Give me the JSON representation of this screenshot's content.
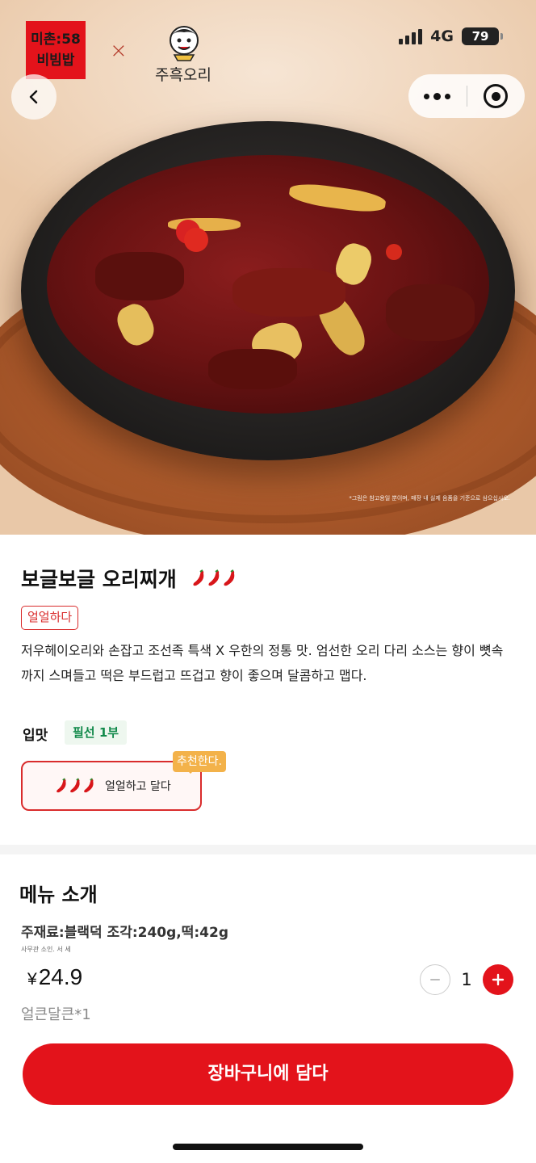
{
  "status_bar": {
    "network": "4G",
    "battery": "79"
  },
  "brand": {
    "collab_badge_line1": "미촌:58",
    "collab_badge_line2": "비빔밥",
    "collab_separator": "×",
    "partner_name": "주흑오리"
  },
  "hero": {
    "disclaimer": "*그림은 참고용일 뿐이며, 매장 내 실제 음품을 기준으로 삼으십시오."
  },
  "product": {
    "name": "보글보글 오리찌개",
    "spice_level": 3,
    "tag": "얼얼하다",
    "description": "저우헤이오리와 손잡고 조선족 특색 X 우한의 정통 맛. 엄선한 오리 다리 소스는 향이 뼛속까지 스며들고 떡은 부드럽고 뜨겁고 향이 좋으며 달콤하고 맵다."
  },
  "options": {
    "label": "입맛",
    "required_note": "필선 1부",
    "recommend_badge": "추천한다.",
    "choices": [
      {
        "label": "얼얼하고 달다",
        "selected": true
      }
    ]
  },
  "menu_intro": {
    "title": "메뉴 소개",
    "ingredients": "주재료:블랙덕 조각:240g,떡:42g",
    "fine_print": "사무관 소인. 서 세"
  },
  "cart": {
    "currency": "¥",
    "price": "24.9",
    "quantity": "1",
    "selected_option": "얼큰달큰*1",
    "add_button": "장바구니에 담다"
  },
  "colors": {
    "brand_red": "#e3131b",
    "accent_green": "#11894a",
    "badge_orange": "#f3b24a"
  }
}
